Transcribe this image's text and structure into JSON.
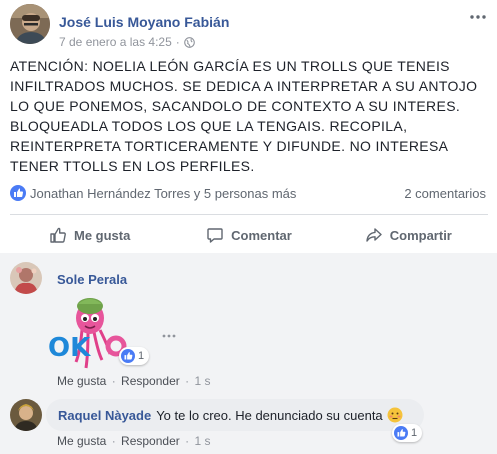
{
  "post": {
    "author": "José Luis Moyano Fabián",
    "date": "7 de enero a las 4:25",
    "separator": "·",
    "more_icon": "ellipsis-icon",
    "text": "ATENCIÓN: NOELIA LEÓN GARCÍA ES UN TROLLS QUE TENEIS INFILTRADOS MUCHOS. SE DEDICA A INTERPRETAR A SU ANTOJO LO QUE PONEMOS, SACANDOLO DE CONTEXTO A SU INTERES. BLOQUEADLA TODOS LOS QUE LA TENGAIS. RECOPILA, REINTERPRETA TORTICERAMENTE Y DIFUNDE. NO INTERESA TENER TTOLLS EN LOS PERFILES."
  },
  "reactions": {
    "reactors": "Jonathan Hernández Torres y 5 personas más",
    "comments_count": "2 comentarios"
  },
  "actions": {
    "like": "Me gusta",
    "comment": "Comentar",
    "share": "Compartir"
  },
  "comments": [
    {
      "author": "Sole Perala",
      "sticker": "OK",
      "reaction_count": "1",
      "like_label": "Me gusta",
      "reply_label": "Responder",
      "separator": "·",
      "time": "1 s"
    },
    {
      "author": "Raquel Nàyade",
      "text": "Yo te lo creo. He denunciado su cuenta",
      "reaction_count": "1",
      "like_label": "Me gusta",
      "reply_label": "Responder",
      "separator": "·",
      "time": "1 s"
    }
  ],
  "colors": {
    "link_blue": "#385898",
    "like_blue": "#4a7bf5",
    "comments_bg": "#f2f3f5",
    "bubble_bg": "#ebedf0",
    "meta_gray": "#90949c"
  }
}
